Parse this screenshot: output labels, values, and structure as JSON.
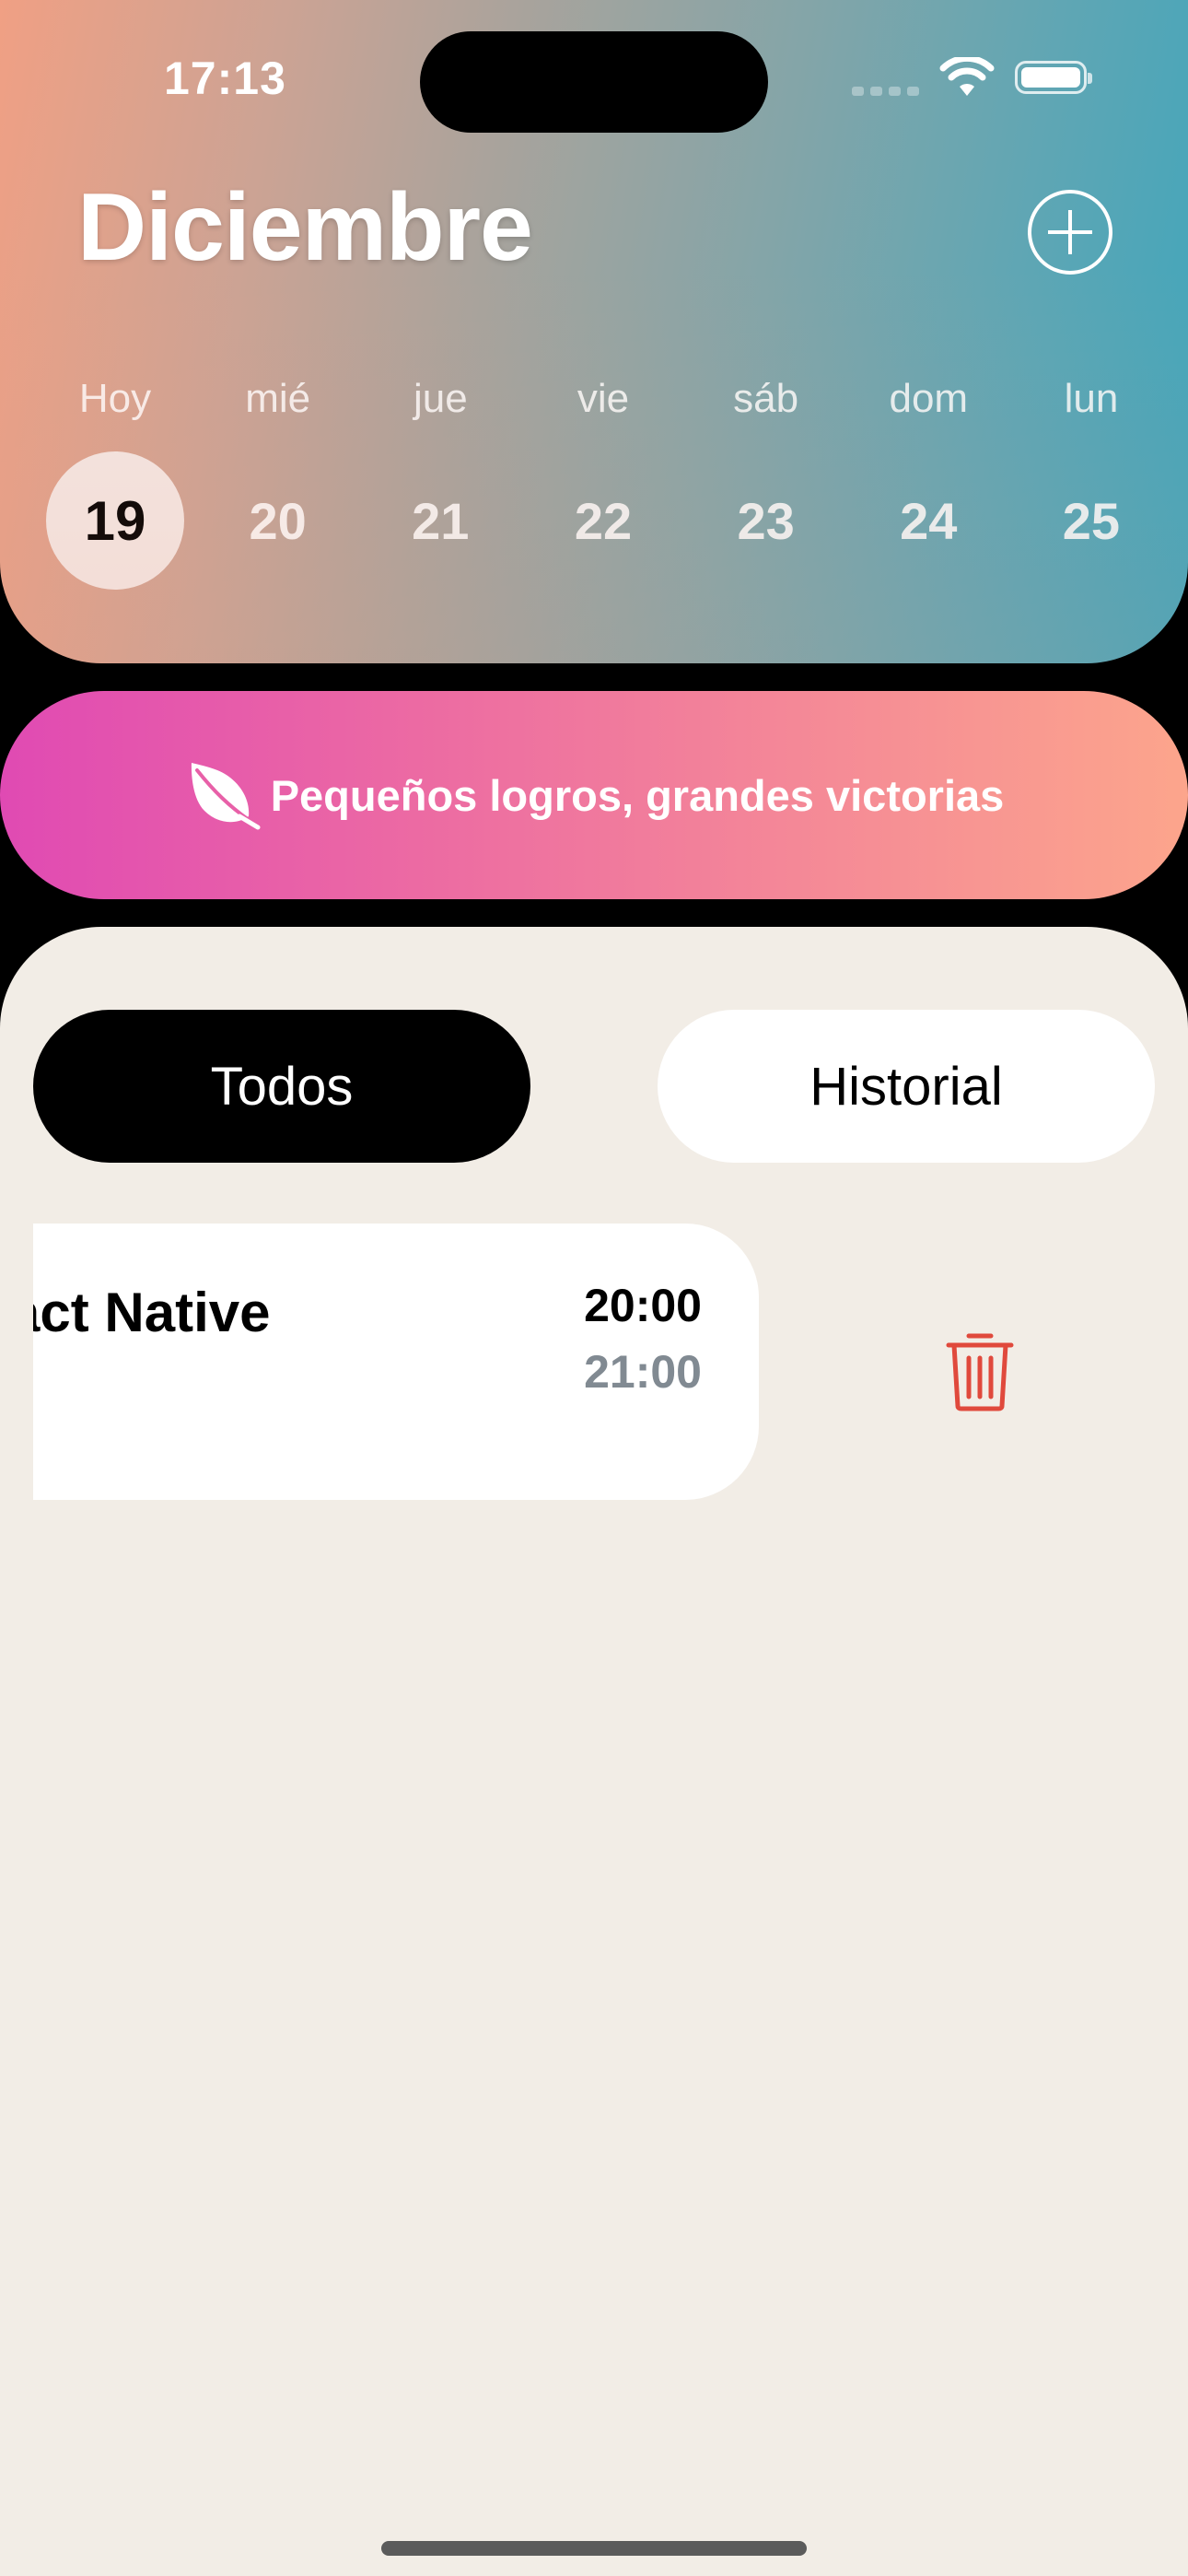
{
  "status_bar": {
    "time": "17:13"
  },
  "header": {
    "month": "Diciembre",
    "week": [
      {
        "label": "Hoy",
        "day": "19",
        "selected": true
      },
      {
        "label": "mié",
        "day": "20"
      },
      {
        "label": "jue",
        "day": "21"
      },
      {
        "label": "vie",
        "day": "22"
      },
      {
        "label": "sáb",
        "day": "23"
      },
      {
        "label": "dom",
        "day": "24"
      },
      {
        "label": "lun",
        "day": "25"
      }
    ]
  },
  "banner": {
    "text": "Pequeños logros, grandes victorias",
    "icon": "leaf-icon"
  },
  "filters": {
    "todos": "Todos",
    "historial": "Historial"
  },
  "tasks": [
    {
      "title": "act Native",
      "start": "20:00",
      "end": "21:00"
    }
  ],
  "colors": {
    "delete": "#e0493c",
    "panel_bg": "#f2ede6",
    "selected_day_bg": "#f2e6e2",
    "end_time": "#818a92"
  }
}
